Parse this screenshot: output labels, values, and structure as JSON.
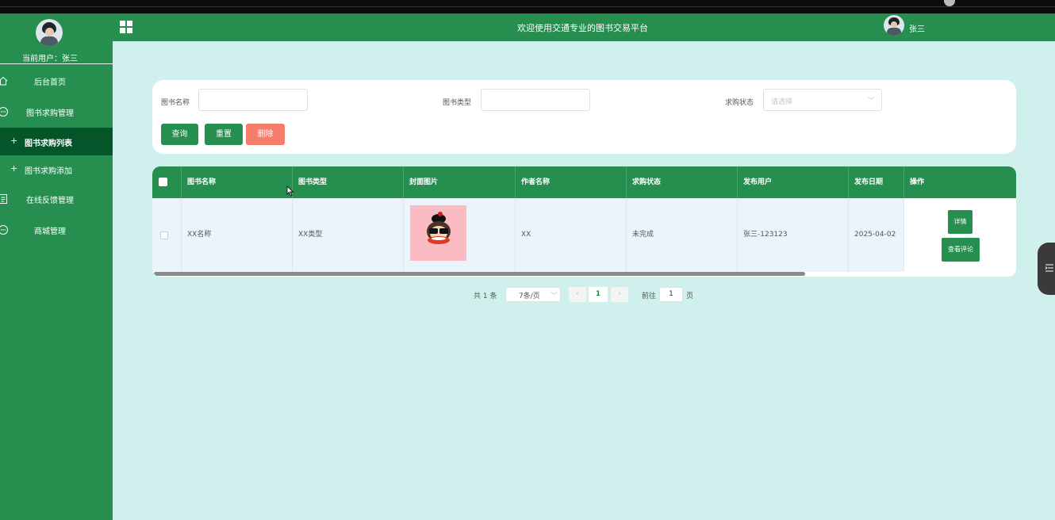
{
  "sidebar": {
    "current_user": "当前用户：张三",
    "items": [
      {
        "label": "后台首页",
        "icon": "home-icon"
      },
      {
        "label": "图书求购管理",
        "icon": "chat-bubble-icon"
      },
      {
        "label": "图书求购列表",
        "icon": "plus-icon"
      },
      {
        "label": "图书求购添加",
        "icon": "plus-icon"
      },
      {
        "label": "在线反馈管理",
        "icon": "document-icon"
      },
      {
        "label": "商城管理",
        "icon": "chat-bubble-icon"
      }
    ]
  },
  "header": {
    "title": "欢迎使用交通专业的图书交易平台",
    "user": "张三"
  },
  "search": {
    "book_name_label": "图书名称",
    "book_type_label": "图书类型",
    "status_label": "求购状态",
    "status_placeholder": "请选择",
    "query_label": "查询",
    "reset_label": "重置",
    "delete_label": "删除"
  },
  "table": {
    "columns": [
      "图书名称",
      "图书类型",
      "封面图片",
      "作者名称",
      "求购状态",
      "发布用户",
      "发布日期",
      "操作"
    ],
    "rows": [
      {
        "name": "XX名称",
        "type": "XX类型",
        "author": "XX",
        "status": "未完成",
        "user": "张三-123123",
        "date": "2025-04-02",
        "detail_label": "详情",
        "comments_label": "查看评论"
      }
    ]
  },
  "pagination": {
    "total": "共 1 条",
    "page_size": "7条/页",
    "current_page": "1",
    "goto_label": "前往",
    "goto_value": "1",
    "page_unit": "页"
  },
  "colors": {
    "primary": "#268e4e",
    "active_nav": "#05552a",
    "danger": "#f47d6c",
    "background": "#d0f0ee"
  }
}
